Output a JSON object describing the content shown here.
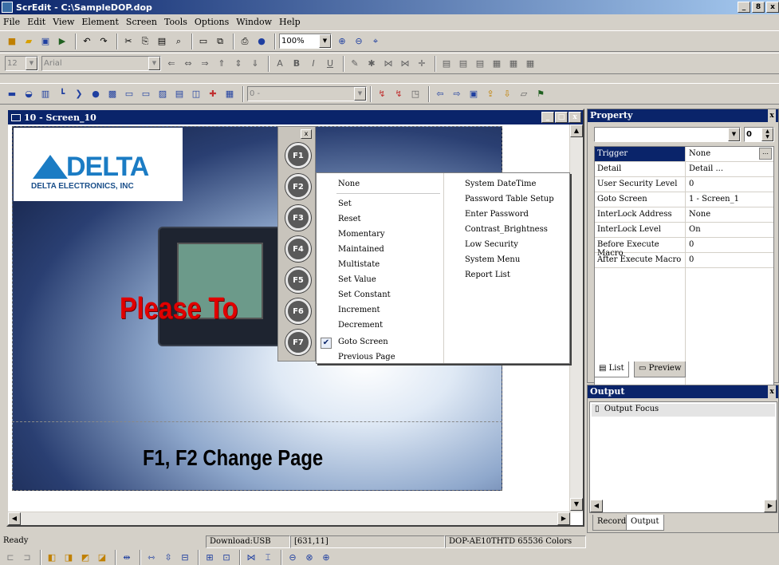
{
  "window": {
    "title": "ScrEdit - C:\\SampleDOP.dop",
    "controls": [
      "_",
      "8",
      "x"
    ]
  },
  "menu": [
    "File",
    "Edit",
    "View",
    "Element",
    "Screen",
    "Tools",
    "Options",
    "Window",
    "Help"
  ],
  "toolbar1": {
    "zoom": "100%"
  },
  "toolbar2": {
    "font_size": "12",
    "font_name": "Arial"
  },
  "toolbar3": {
    "value_combo": "0 -"
  },
  "child_window": {
    "title": "10 - Screen_10",
    "controls": [
      "_",
      "□",
      "x"
    ]
  },
  "screen": {
    "logo": "DELTA",
    "logo_sub": "DELTA ELECTRONICS, INC",
    "please_text": "Please To",
    "change_text": "F1, F2  Change Page",
    "fkeys": [
      "F1",
      "F2",
      "F3",
      "F4",
      "F5",
      "F6",
      "F7"
    ]
  },
  "context_menu": {
    "left": [
      "None",
      "Set",
      "Reset",
      "Momentary",
      "Maintained",
      "Multistate",
      "Set Value",
      "Set Constant",
      "Increment",
      "Decrement",
      "Goto Screen",
      "Previous Page"
    ],
    "checked": "Goto Screen",
    "right": [
      "System DateTime",
      "Password Table Setup",
      "Enter Password",
      "Contrast_Brightness",
      "Low Security",
      "System Menu",
      "Report List"
    ]
  },
  "property": {
    "title": "Property",
    "spin_value": "0",
    "rows": [
      {
        "k": "Trigger",
        "v": "None"
      },
      {
        "k": "Detail",
        "v": "Detail ..."
      },
      {
        "k": "User Security Level",
        "v": "0"
      },
      {
        "k": "Goto Screen",
        "v": "1 - Screen_1"
      },
      {
        "k": "InterLock Address",
        "v": "None"
      },
      {
        "k": "InterLock Level",
        "v": "On"
      },
      {
        "k": "Before Execute Macro",
        "v": "0"
      },
      {
        "k": "After Execute Macro",
        "v": "0"
      }
    ],
    "tabs": [
      "List",
      "Preview"
    ]
  },
  "output": {
    "title": "Output",
    "item": "Output Focus",
    "tabs": [
      "Record",
      "Output"
    ]
  },
  "status": {
    "ready": "Ready",
    "download": "Download:USB",
    "coords": "[631,11]",
    "model": "DOP-AE10THTD 65536 Colors"
  }
}
